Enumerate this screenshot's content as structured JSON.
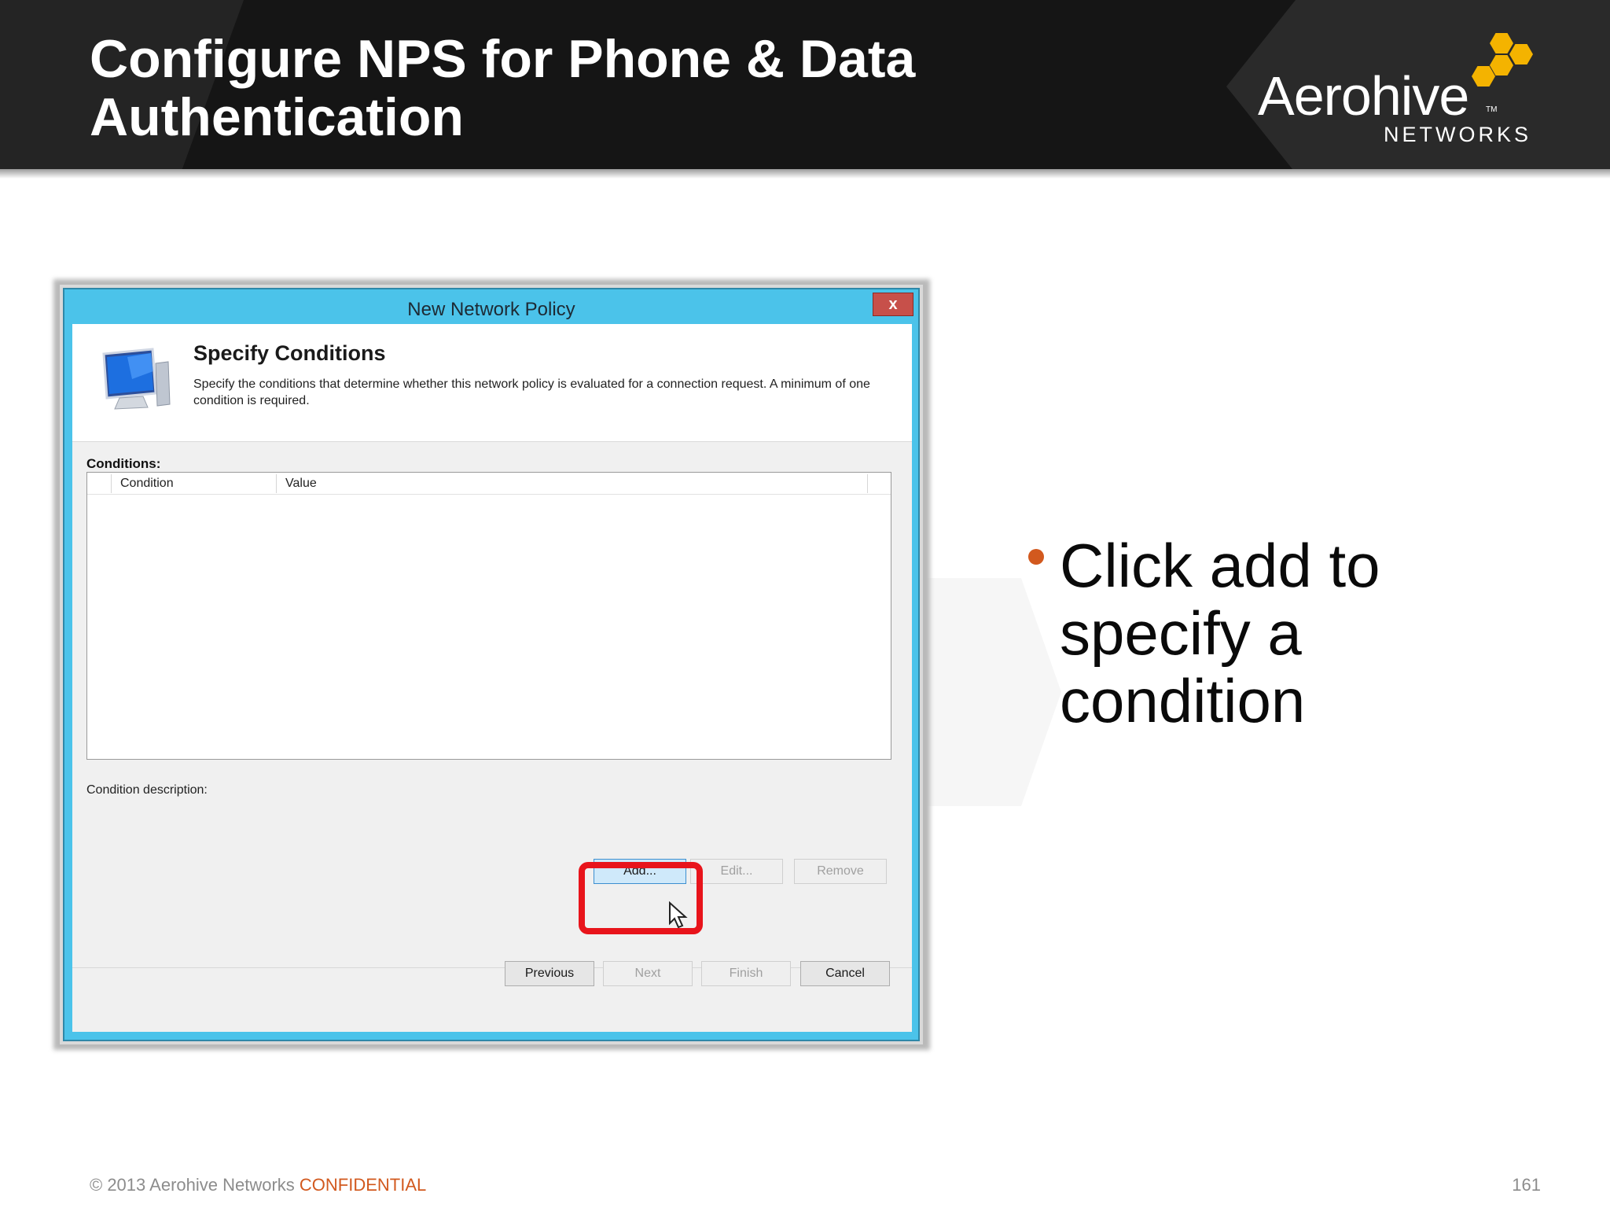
{
  "slide": {
    "title_line1": "Configure NPS for Phone & Data",
    "title_line2": "Authentication",
    "logo_word": "Aerohive",
    "logo_tm": "TM",
    "logo_sub": "NETWORKS",
    "accent_color": "#f4b300",
    "bullet_color": "#d2591e"
  },
  "dialog": {
    "title": "New Network Policy",
    "close_label": "x",
    "heading": "Specify Conditions",
    "description": "Specify the conditions that determine whether this network policy is evaluated for a connection request. A minimum of one condition is required.",
    "conditions_label": "Conditions:",
    "columns": [
      "Condition",
      "Value"
    ],
    "condition_description_label": "Condition description:",
    "buttons": {
      "add": "Add...",
      "edit": "Edit...",
      "remove": "Remove",
      "previous": "Previous",
      "next": "Next",
      "finish": "Finish",
      "cancel": "Cancel"
    },
    "icon": "monitor-icon"
  },
  "bullet": {
    "text": "Click add to specify a condition"
  },
  "footer": {
    "copyright": "© 2013 Aerohive Networks",
    "confidential": "CONFIDENTIAL",
    "page_number": "161"
  }
}
